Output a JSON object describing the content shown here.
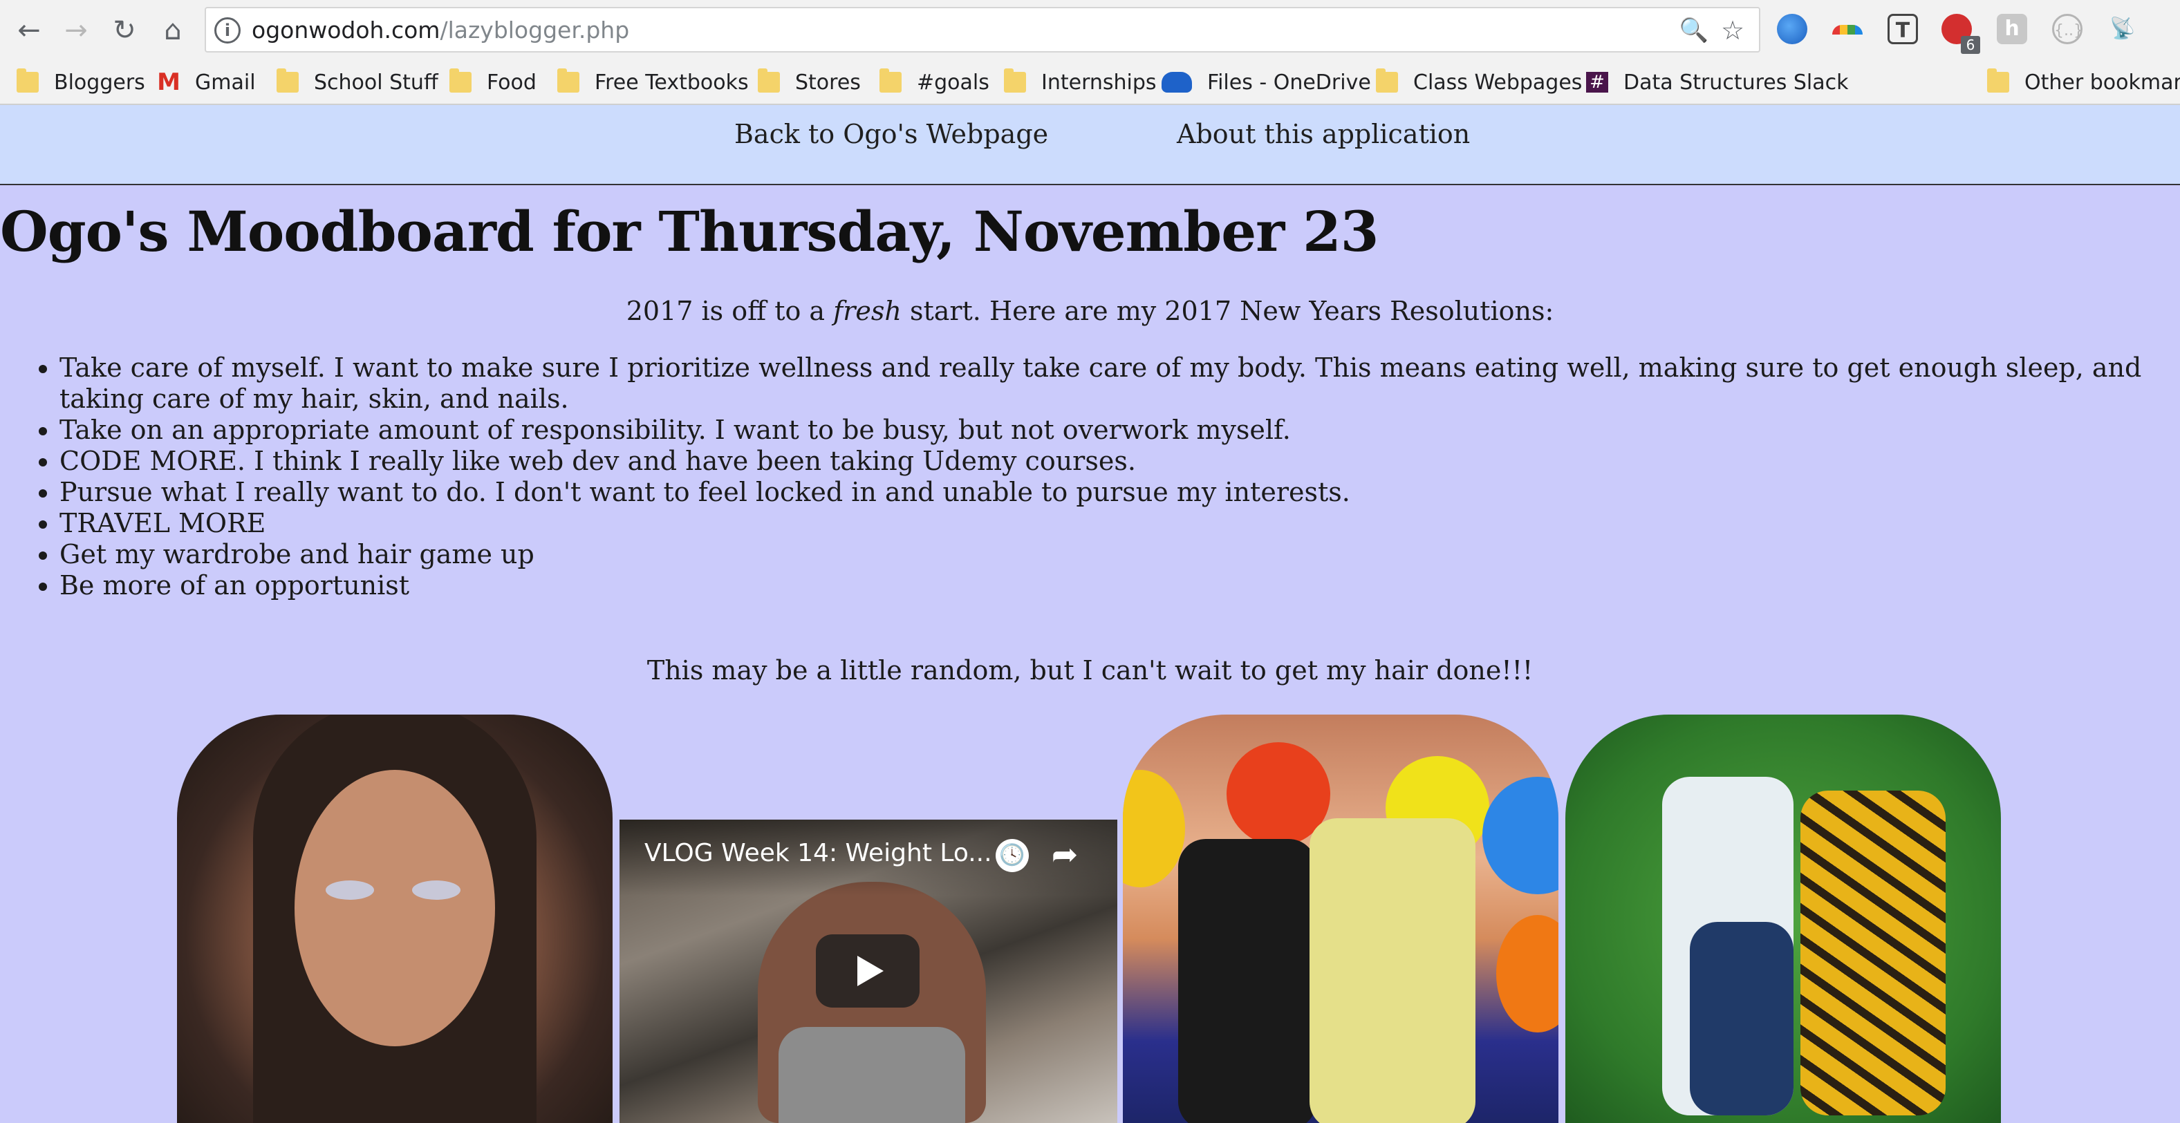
{
  "browser": {
    "nav": {
      "back_icon": "←",
      "forward_icon": "→",
      "reload_icon": "↻",
      "home_icon": "⌂"
    },
    "omnibox": {
      "info_icon": "i",
      "domain": "ogonwodoh.com",
      "path": "/lazyblogger.php",
      "zoom_icon": "🔍",
      "star_icon": "☆"
    },
    "extensions": {
      "badge_count": "6"
    },
    "bookmarks": [
      {
        "label": "Bloggers",
        "icon": "folder-icon"
      },
      {
        "label": "Gmail",
        "icon": "gmail-icon",
        "glyph": "M"
      },
      {
        "label": "School Stuff",
        "icon": "folder-icon"
      },
      {
        "label": "Food",
        "icon": "folder-icon"
      },
      {
        "label": "Free Textbooks",
        "icon": "folder-icon"
      },
      {
        "label": "Stores",
        "icon": "folder-icon"
      },
      {
        "label": "#goals",
        "icon": "folder-icon"
      },
      {
        "label": "Internships",
        "icon": "folder-icon"
      },
      {
        "label": "Files - OneDrive",
        "icon": "cloud-icon"
      },
      {
        "label": "Class Webpages",
        "icon": "folder-icon"
      },
      {
        "label": "Data Structures Slack",
        "icon": "slack-icon",
        "glyph": "#"
      },
      {
        "label": "Other bookmarks",
        "icon": "folder-icon"
      }
    ]
  },
  "site_nav": {
    "back_link": "Back to Ogo's Webpage",
    "about_link": "About this application"
  },
  "main": {
    "title": "Ogo's Moodboard for Thursday, November 23",
    "intro_before": "2017 is off to a ",
    "intro_emphasis": "fresh",
    "intro_after": " start. Here are my 2017 New Years Resolutions:",
    "resolutions": [
      "Take care of myself. I want to make sure I prioritize wellness and really take care of my body. This means eating well, making sure to get enough sleep, and taking care of my hair, skin, and nails.",
      "Take on an appropriate amount of responsibility. I want to be busy, but not overwork myself.",
      "CODE MORE. I think I really like web dev and have been taking Udemy courses.",
      "Pursue what I really want to do. I don't want to feel locked in and unable to pursue my interests.",
      "TRAVEL MORE",
      "Get my wardrobe and hair game up",
      "Be more of an opportunist"
    ],
    "random_note": "This may be a little random, but I can't wait to get my hair done!!!"
  },
  "video": {
    "title": "VLOG Week 14: Weight Lo...",
    "clock_icon": "🕓",
    "share_icon": "➦"
  },
  "colors": {
    "page_bg": "#cbcbfb",
    "nav_bg": "#ccdcfd",
    "chrome_bg": "#f2f2f2"
  }
}
